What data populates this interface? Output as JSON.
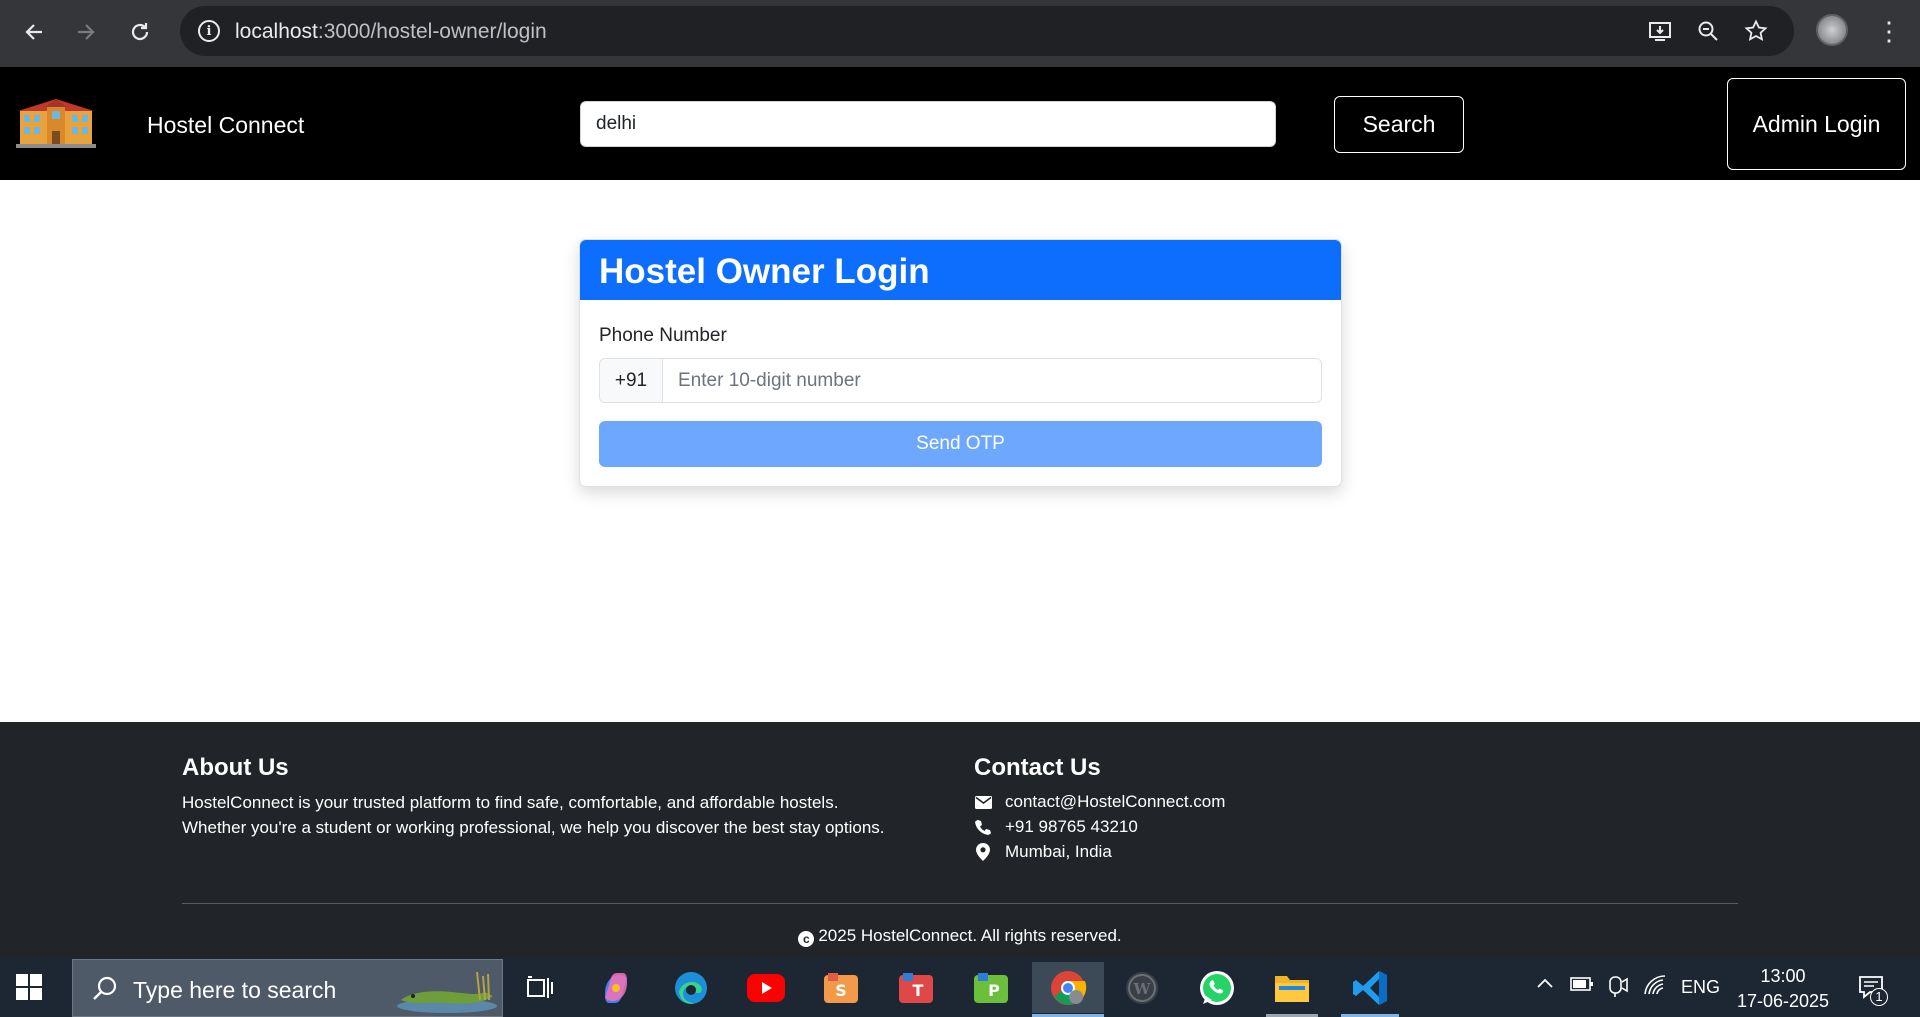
{
  "browser": {
    "url_host": "localhost",
    "url_path": ":3000/hostel-owner/login"
  },
  "navbar": {
    "brand": "Hostel Connect",
    "search_value": "delhi",
    "search_button": "Search",
    "admin_button": "Admin Login"
  },
  "login_card": {
    "title": "Hostel Owner Login",
    "phone_label": "Phone Number",
    "country_code": "+91",
    "phone_placeholder": "Enter 10-digit number",
    "phone_value": "",
    "submit_button": "Send OTP",
    "submit_color": "#6ea8fe",
    "header_color": "#0d6efd"
  },
  "footer": {
    "about_title": "About Us",
    "about_text": "HostelConnect is your trusted platform to find safe, comfortable, and affordable hostels. Whether you're a student or working professional, we help you discover the best stay options.",
    "contact_title": "Contact Us",
    "contacts": [
      {
        "icon": "envelope-icon",
        "text": "contact@HostelConnect.com"
      },
      {
        "icon": "phone-icon",
        "text": "+91 98765 43210"
      },
      {
        "icon": "location-pin-icon",
        "text": "Mumbai, India"
      }
    ],
    "copyright": "2025 HostelConnect. All rights reserved."
  },
  "taskbar": {
    "search_placeholder": "Type here to search",
    "language": "ENG",
    "time": "13:00",
    "date": "17-06-2025",
    "notification_count": "1"
  }
}
